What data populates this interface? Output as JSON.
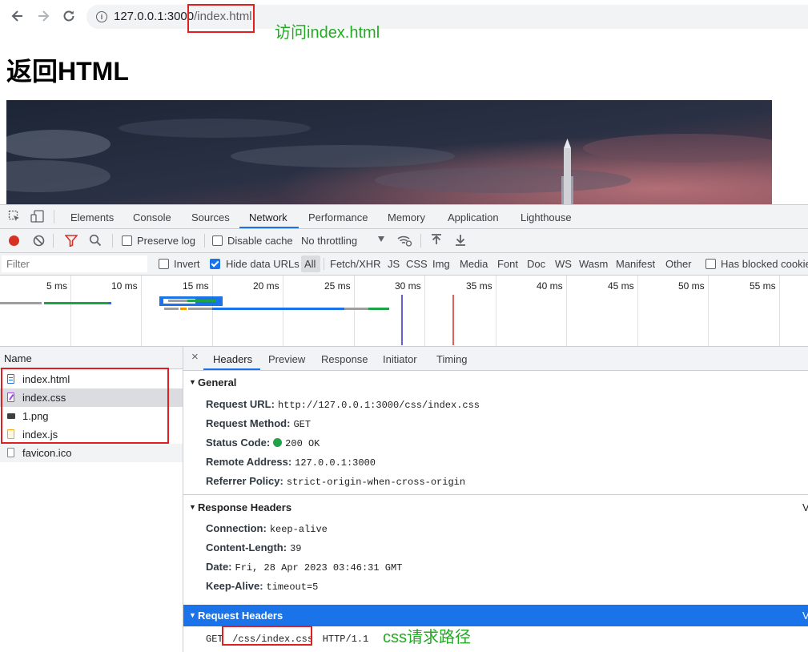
{
  "browser": {
    "back_icon": "arrow-left-icon",
    "forward_icon": "arrow-right-icon",
    "reload_icon": "reload-icon",
    "url_host": "127.0.0.1:3000",
    "url_path": "/index.html"
  },
  "annotations": {
    "url_note": "访问index.html",
    "css_note": "css请求路径",
    "highlight_color": "#e02020",
    "note_color": "#22aa22"
  },
  "page": {
    "heading": "返回HTML"
  },
  "devtools": {
    "tabs": [
      "Elements",
      "Console",
      "Sources",
      "Network",
      "Performance",
      "Memory",
      "Application",
      "Lighthouse"
    ],
    "active_tab": "Network",
    "toolbar": {
      "preserve_log": "Preserve log",
      "disable_cache": "Disable cache",
      "throttling": "No throttling"
    },
    "filter": {
      "placeholder": "Filter",
      "invert": "Invert",
      "hide_data_urls": "Hide data URLs",
      "types": [
        "All",
        "Fetch/XHR",
        "JS",
        "CSS",
        "Img",
        "Media",
        "Font",
        "Doc",
        "WS",
        "Wasm",
        "Manifest",
        "Other"
      ],
      "blocked_cookies": "Has blocked cookies"
    },
    "timeline_ticks": [
      "5 ms",
      "10 ms",
      "15 ms",
      "20 ms",
      "25 ms",
      "30 ms",
      "35 ms",
      "40 ms",
      "45 ms",
      "50 ms",
      "55 ms"
    ],
    "name_column": "Name",
    "requests": [
      {
        "name": "index.html",
        "type": "document"
      },
      {
        "name": "index.css",
        "type": "stylesheet"
      },
      {
        "name": "1.png",
        "type": "image"
      },
      {
        "name": "index.js",
        "type": "script"
      },
      {
        "name": "favicon.ico",
        "type": "other"
      }
    ],
    "detail_tabs": [
      "Headers",
      "Preview",
      "Response",
      "Initiator",
      "Timing"
    ],
    "general": {
      "title": "General",
      "rows": [
        {
          "key": "Request URL:",
          "value": "http://127.0.0.1:3000/css/index.css"
        },
        {
          "key": "Request Method:",
          "value": "GET"
        },
        {
          "key": "Status Code:",
          "value": "200 OK"
        },
        {
          "key": "Remote Address:",
          "value": "127.0.0.1:3000"
        },
        {
          "key": "Referrer Policy:",
          "value": "strict-origin-when-cross-origin"
        }
      ]
    },
    "response_headers": {
      "title": "Response Headers",
      "view_source": "V",
      "rows": [
        {
          "key": "Connection:",
          "value": "keep-alive"
        },
        {
          "key": "Content-Length:",
          "value": "39"
        },
        {
          "key": "Date:",
          "value": "Fri, 28 Apr 2023 03:46:31 GMT"
        },
        {
          "key": "Keep-Alive:",
          "value": "timeout=5"
        }
      ]
    },
    "request_headers": {
      "title": "Request Headers",
      "view_source": "V",
      "method": "GET",
      "path": "/css/index.css",
      "protocol": "HTTP/1.1"
    }
  }
}
